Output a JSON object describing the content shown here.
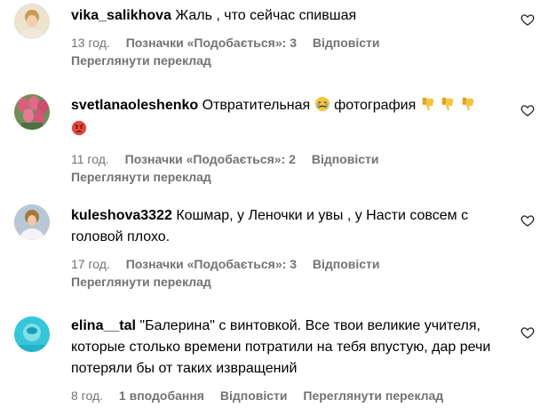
{
  "comments": [
    {
      "username": "vika_salikhova",
      "text": "Жаль , что сейчас спившая",
      "time": "13 год.",
      "likes_label": "Позначки «Подобається»: 3",
      "reply": "Відповісти",
      "translate": "Переглянути переклад",
      "avatar_icon": "avatar-photo"
    },
    {
      "username": "svetlanaoleshenko",
      "text_before": "Отвратительная",
      "text_middle": "фотография",
      "emoji_1": "crying-face-emoji",
      "emoji_2": "thumbs-down-emoji",
      "emoji_3": "angry-face-emoji",
      "time": "11 год.",
      "likes_label": "Позначки «Подобається»: 2",
      "reply": "Відповісти",
      "translate": "Переглянути переклад",
      "avatar_icon": "tulips-photo"
    },
    {
      "username": "kuleshova3322",
      "text": "Кошмар, у Леночки и увы , у Насти совсем с головой плохо.",
      "time": "17 год.",
      "likes_label": "Позначки «Подобається»: 3",
      "reply": "Відповісти",
      "translate": "Переглянути переклад",
      "avatar_icon": "avatar-photo"
    },
    {
      "username": "elina__tal",
      "text": "\"Балерина\" с винтовкой. Все твои великие учителя, которые столько времени потратили на тебя впустую, дар речи потеряли бы от таких извращений",
      "time": "8 год.",
      "likes_label": "1 вподобання",
      "reply": "Відповісти",
      "translate": "Переглянути переклад",
      "avatar_icon": "pool-photo"
    }
  ],
  "colors": {
    "meta": "#737373",
    "text": "#000000",
    "background": "#ffffff"
  }
}
